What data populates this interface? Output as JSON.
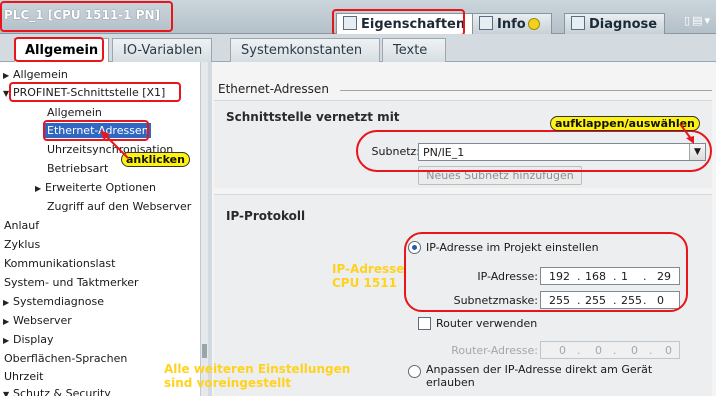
{
  "window": {
    "title": "PLC_1 [CPU 1511-1 PN]",
    "top_tabs": [
      {
        "label": "Eigenschaften",
        "icon": "properties-icon",
        "active": true
      },
      {
        "label": "Info",
        "icon": "info-icon",
        "active": false
      },
      {
        "label": "Diagnose",
        "icon": "diagnose-icon",
        "active": false
      }
    ],
    "window_controls": "▯▤▾"
  },
  "sub_tabs": [
    {
      "label": "Allgemein",
      "active": true
    },
    {
      "label": "IO-Variablen",
      "active": false
    },
    {
      "label": "Systemkonstanten",
      "active": false
    },
    {
      "label": "Texte",
      "active": false
    }
  ],
  "nav": {
    "items": [
      {
        "label": "Allgemein",
        "arrow": "▶"
      },
      {
        "label": "PROFINET-Schnittstelle [X1]",
        "arrow": "▼"
      },
      {
        "label": "Allgemein",
        "arrow": ""
      },
      {
        "label": "Ethernet-Adressen",
        "arrow": ""
      },
      {
        "label": "Uhrzeitsynchronisation",
        "arrow": ""
      },
      {
        "label": "Betriebsart",
        "arrow": ""
      },
      {
        "label": "Erweiterte Optionen",
        "arrow": "▶"
      },
      {
        "label": "Zugriff auf den Webserver",
        "arrow": ""
      },
      {
        "label": "Anlauf",
        "arrow": ""
      },
      {
        "label": "Zyklus",
        "arrow": ""
      },
      {
        "label": "Kommunikationslast",
        "arrow": ""
      },
      {
        "label": "System- und Taktmerker",
        "arrow": ""
      },
      {
        "label": "Systemdiagnose",
        "arrow": "▶"
      },
      {
        "label": "Webserver",
        "arrow": "▶"
      },
      {
        "label": "Display",
        "arrow": "▶"
      },
      {
        "label": "Oberflächen-Sprachen",
        "arrow": ""
      },
      {
        "label": "Uhrzeit",
        "arrow": ""
      },
      {
        "label": "Schutz & Security",
        "arrow": "▼"
      }
    ]
  },
  "content": {
    "section_title": "Ethernet-Adressen",
    "interface_group": {
      "title": "Schnittstelle vernetzt mit",
      "subnet_label": "Subnetz:",
      "subnet_value": "PN/IE_1",
      "add_subnet_button": "Neues Subnetz hinzufügen"
    },
    "ip_group": {
      "title": "IP-Protokoll",
      "radio_set_in_project": "IP-Adresse im Projekt einstellen",
      "ip_label": "IP-Adresse:",
      "ip_octets": [
        "192",
        "168",
        "1",
        "29"
      ],
      "mask_label": "Subnetzmaske:",
      "mask_octets": [
        "255",
        "255",
        "255",
        "0"
      ],
      "router_checkbox": "Router verwenden",
      "router_label": "Router-Adresse:",
      "router_octets": [
        "0",
        "0",
        "0",
        "0"
      ],
      "radio_adjust_line1": "Anpassen der IP-Adresse direkt am Gerät",
      "radio_adjust_line2": "erlauben"
    }
  },
  "annotations": {
    "aufklappen": "aufklappen/auswählen",
    "anklicken": "anklicken",
    "ip_note_line1": "IP-Adresse",
    "ip_note_line2": "CPU 1511",
    "bottom_note_line1": "Alle weiteren Einstellungen",
    "bottom_note_line2": "sind voreingestellt"
  },
  "colors": {
    "annotation_red": "#e8151b",
    "annotation_yellow": "#fdf211",
    "selection_blue": "#2f67c2",
    "panel_gray": "#eceeef"
  }
}
